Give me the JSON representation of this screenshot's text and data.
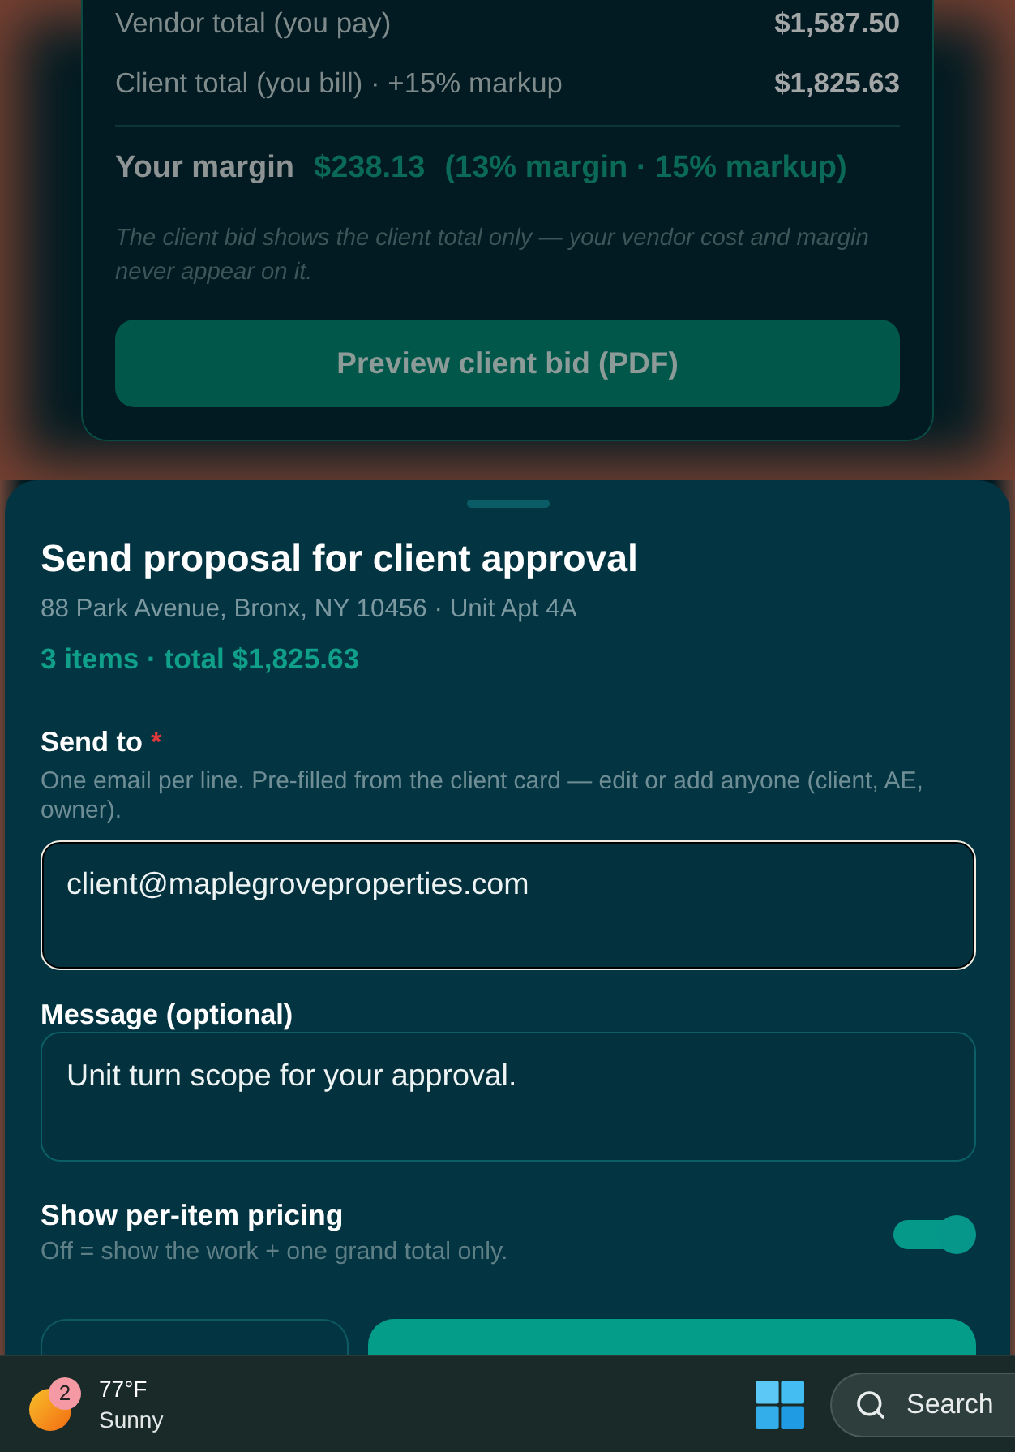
{
  "cost_summary": {
    "rows": [
      {
        "label": "Vendor total (you pay)",
        "value": "$1,587.50"
      },
      {
        "label": "Client total (you bill) · +15% markup",
        "value": "$1,825.63"
      }
    ],
    "margin": {
      "label": "Your margin",
      "amount": "$238.13",
      "detail": "(13% margin · 15% markup)"
    },
    "note": "The client bid shows the client total only — your vendor cost and margin never appear on it.",
    "preview_button": "Preview client bid (PDF)"
  },
  "sheet": {
    "title": "Send proposal for client approval",
    "address": "88 Park Avenue, Bronx, NY 10456 · Unit Apt 4A",
    "summary": "3 items · total $1,825.63",
    "send_to": {
      "label": "Send to",
      "required_mark": "*",
      "hint": "One email per line. Pre-filled from the client card — edit or add anyone (client, AE, owner).",
      "value": "client@maplegroveproperties.com",
      "focused": true
    },
    "message": {
      "label": "Message (optional)",
      "value": "Unit turn scope for your approval.",
      "focused": false
    },
    "per_item_pricing": {
      "label": "Show per-item pricing",
      "hint": "Off = show the work + one grand total only.",
      "on": true
    },
    "buttons": [
      {
        "kind": "secondary"
      },
      {
        "kind": "primary"
      }
    ]
  },
  "taskbar": {
    "weather": {
      "badge": "2",
      "temperature": "77°F",
      "condition": "Sunny"
    },
    "search": {
      "label": "Search"
    }
  }
}
